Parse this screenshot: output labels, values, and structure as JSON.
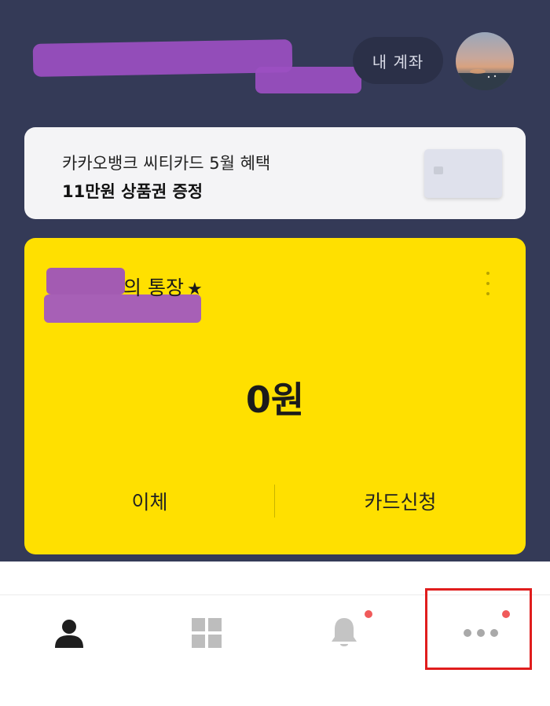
{
  "header": {
    "account_button_label": "내 계좌"
  },
  "promo": {
    "line1": "카카오뱅크 씨티카드 5월 혜택",
    "line2": "11만원 상품권 증정"
  },
  "account": {
    "name_suffix": "의 통장",
    "balance": "0원",
    "actions": [
      "이체",
      "카드신청"
    ]
  },
  "bottom_nav": {
    "items": [
      {
        "icon": "person-icon",
        "badge": false
      },
      {
        "icon": "grid-icon",
        "badge": false
      },
      {
        "icon": "bell-icon",
        "badge": true
      },
      {
        "icon": "more-icon",
        "badge": true
      }
    ]
  },
  "colors": {
    "header_bg": "#343a57",
    "account_card": "#ffe000",
    "badge": "#f05a5a",
    "highlight": "#e01d1d"
  }
}
